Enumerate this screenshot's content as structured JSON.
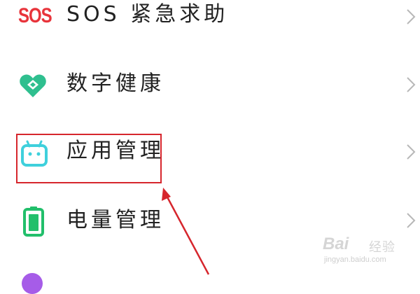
{
  "settings_list": {
    "items": [
      {
        "id": "sos",
        "label": "SOS 紧急求助",
        "icon": "sos-icon",
        "icon_text": "SOS",
        "color": "#e8343b"
      },
      {
        "id": "digital-health",
        "label": "数字健康",
        "icon": "digital-wellbeing-icon",
        "color": "#2fbf8f"
      },
      {
        "id": "app-management",
        "label": "应用管理",
        "icon": "android-icon",
        "color": "#3fd0dc",
        "highlighted": true
      },
      {
        "id": "battery",
        "label": "电量管理",
        "icon": "battery-icon",
        "color": "#22bf6b"
      }
    ]
  },
  "annotation": {
    "highlight_color": "#d6262d",
    "arrow_target": "app-management"
  },
  "watermark": {
    "brand": "Bai",
    "text": "经验",
    "url": "jingyan.baidu.com"
  }
}
